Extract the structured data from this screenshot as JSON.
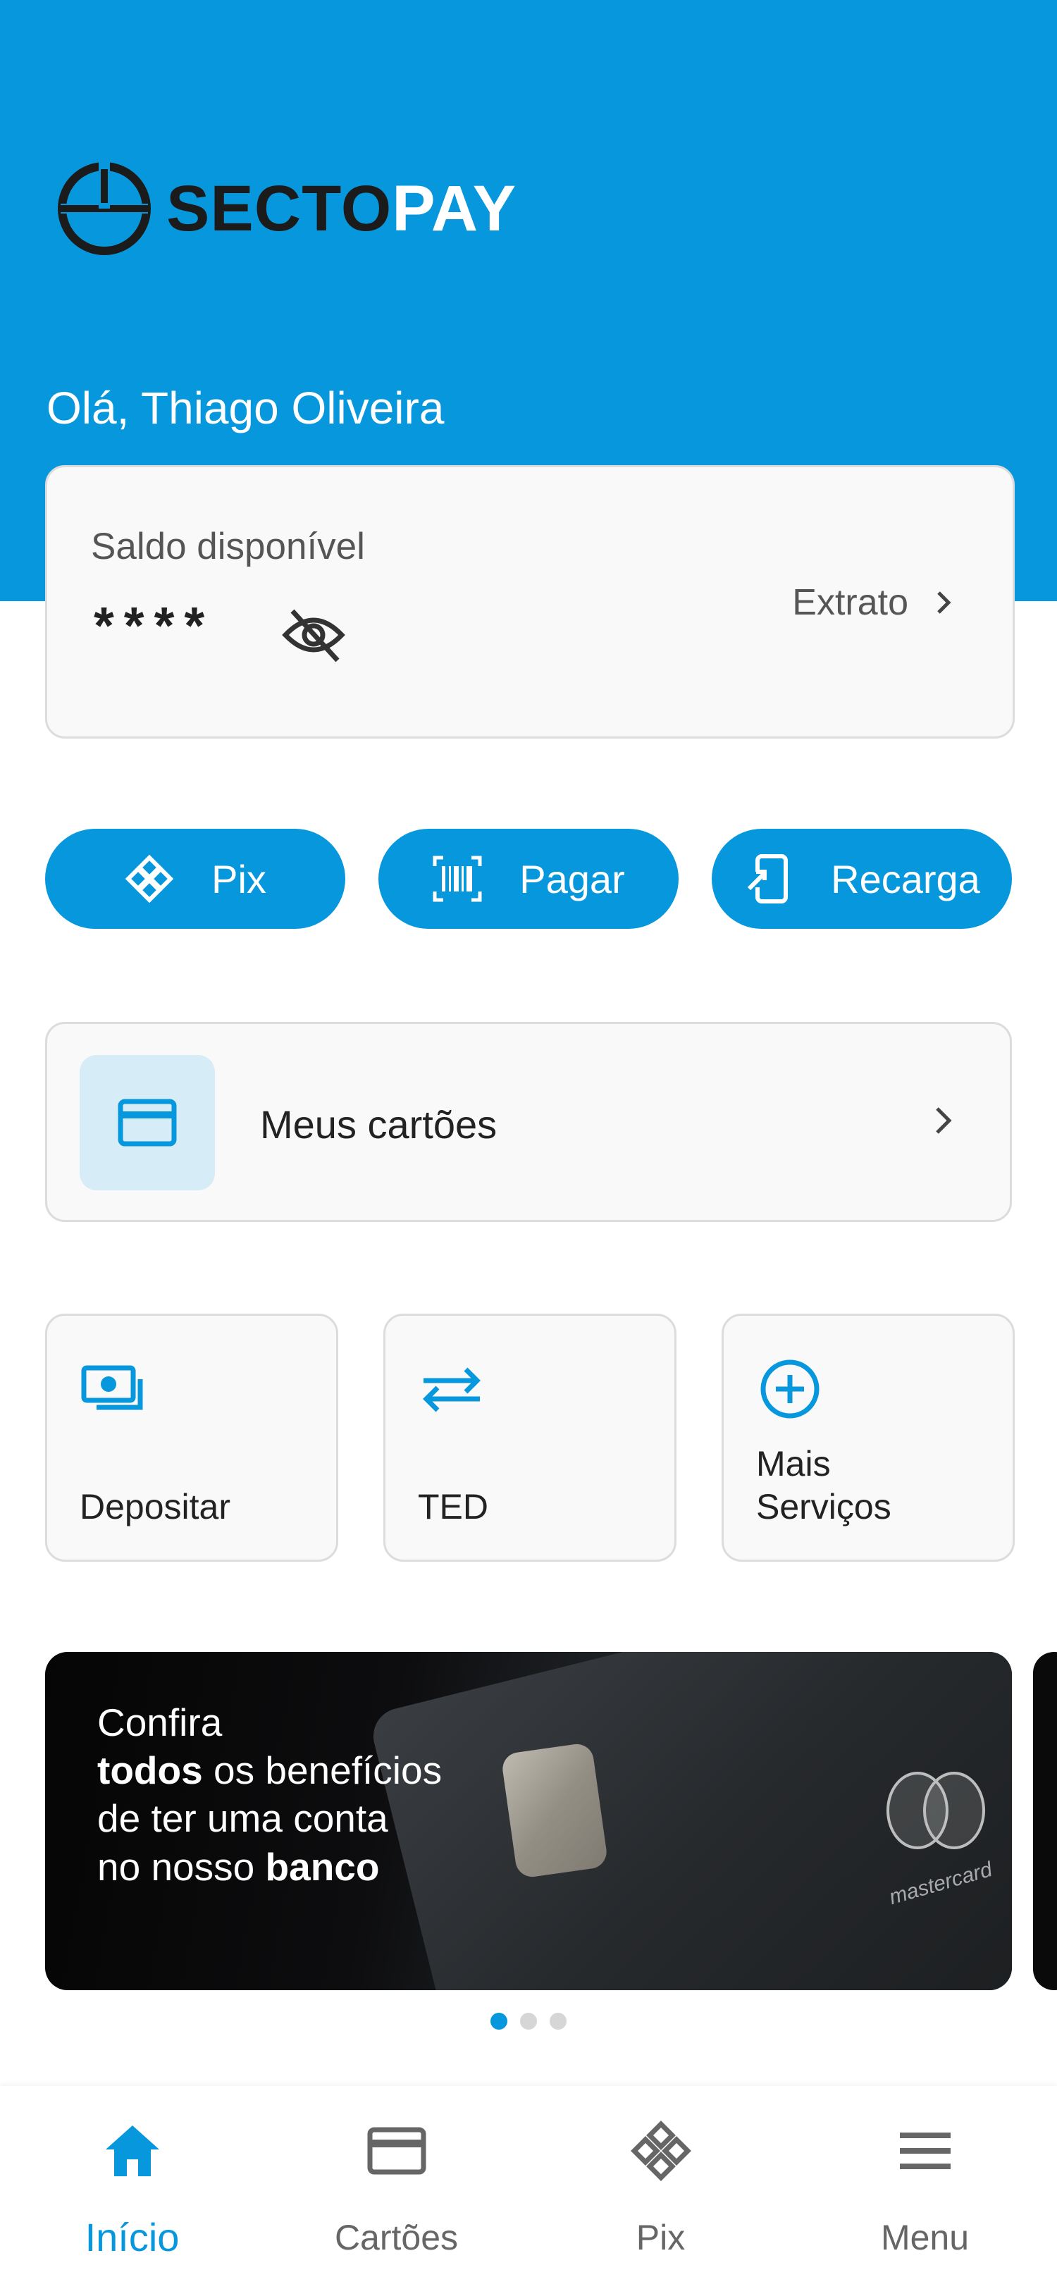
{
  "brand": {
    "logo_part1": "SECTO",
    "logo_part2": "PAY",
    "logo_icon": "sectopay-logo-icon",
    "primary_color": "#0797dd"
  },
  "greeting": "Olá, Thiago Oliveira",
  "balance": {
    "label": "Saldo disponível",
    "value": "****",
    "visibility_icon": "eye-off-icon",
    "statement_link": "Extrato"
  },
  "quick_actions": [
    {
      "label": "Pix",
      "icon": "pix-icon"
    },
    {
      "label": "Pagar",
      "icon": "barcode-icon"
    },
    {
      "label": "Recarga",
      "icon": "phone-recharge-icon"
    }
  ],
  "cards_entry": {
    "label": "Meus cartões",
    "icon": "credit-card-icon"
  },
  "services": [
    {
      "label": "Depositar",
      "icon": "deposit-cash-icon"
    },
    {
      "label": "TED",
      "icon": "transfer-arrows-icon"
    },
    {
      "label": "Mais Serviços",
      "icon": "add-circle-icon"
    }
  ],
  "banner": {
    "line1": "Confira",
    "line2_bold": "todos",
    "line2_rest": " os benefícios",
    "line3": "de ter uma conta",
    "line4_prefix": "no nosso ",
    "line4_bold": "banco",
    "card_brand": "mastercard",
    "slides_total": 3,
    "slide_active": 1
  },
  "bottom_nav": [
    {
      "label": "Início",
      "icon": "home-icon",
      "active": true
    },
    {
      "label": "Cartões",
      "icon": "credit-card-icon",
      "active": false
    },
    {
      "label": "Pix",
      "icon": "pix-icon",
      "active": false
    },
    {
      "label": "Menu",
      "icon": "hamburger-menu-icon",
      "active": false
    }
  ]
}
